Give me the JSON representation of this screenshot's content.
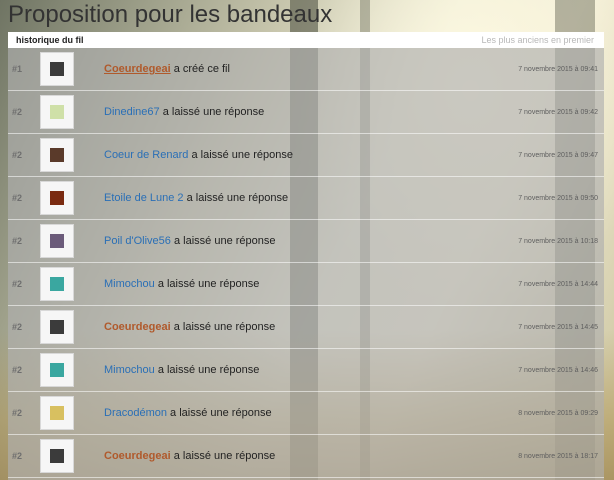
{
  "page": {
    "title": "Proposition pour les bandeaux"
  },
  "panel": {
    "heading": "historique du fil",
    "sort_label": "Les plus anciens en premier"
  },
  "posts": [
    {
      "num": "#1",
      "user": "Coeurdegeai",
      "action": "a créé ce fil",
      "date": "7 novembre 2015 à 09:41",
      "style": "special-underline",
      "avatar_color": "#3b3b3b"
    },
    {
      "num": "#2",
      "user": "Dinedine67",
      "action": "a laissé une réponse",
      "date": "7 novembre 2015 à 09:42",
      "style": "normal",
      "avatar_color": "#cfe0a8"
    },
    {
      "num": "#2",
      "user": "Coeur de Renard",
      "action": "a laissé une réponse",
      "date": "7 novembre 2015 à 09:47",
      "style": "normal",
      "avatar_color": "#5a3a2a"
    },
    {
      "num": "#2",
      "user": "Etoile de Lune 2",
      "action": "a laissé une réponse",
      "date": "7 novembre 2015 à 09:50",
      "style": "normal",
      "avatar_color": "#7a2a10"
    },
    {
      "num": "#2",
      "user": "Poil d'Olive56",
      "action": "a laissé une réponse",
      "date": "7 novembre 2015 à 10:18",
      "style": "normal",
      "avatar_color": "#6b5b7a"
    },
    {
      "num": "#2",
      "user": "Mimochou",
      "action": "a laissé une réponse",
      "date": "7 novembre 2015 à 14:44",
      "style": "normal",
      "avatar_color": "#3aa7a0"
    },
    {
      "num": "#2",
      "user": "Coeurdegeai",
      "action": "a laissé une réponse",
      "date": "7 novembre 2015 à 14:45",
      "style": "special",
      "avatar_color": "#3b3b3b"
    },
    {
      "num": "#2",
      "user": "Mimochou",
      "action": "a laissé une réponse",
      "date": "7 novembre 2015 à 14:46",
      "style": "normal",
      "avatar_color": "#3aa7a0"
    },
    {
      "num": "#2",
      "user": "Dracodémon",
      "action": "a laissé une réponse",
      "date": "8 novembre 2015 à 09:29",
      "style": "normal",
      "avatar_color": "#d8c060"
    },
    {
      "num": "#2",
      "user": "Coeurdegeai",
      "action": "a laissé une réponse",
      "date": "8 novembre 2015 à 18:17",
      "style": "special",
      "avatar_color": "#3b3b3b"
    }
  ]
}
